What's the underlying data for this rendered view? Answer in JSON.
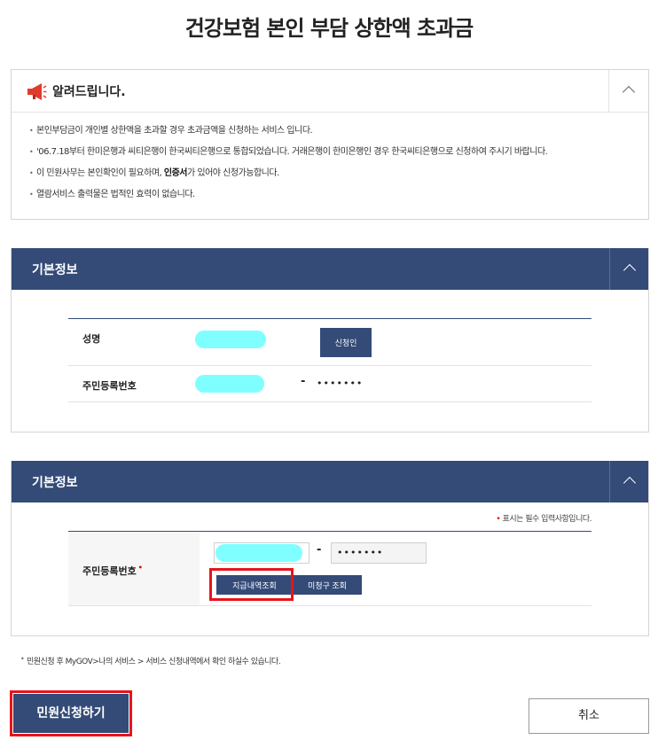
{
  "page": {
    "title": "건강보험 본인 부담 상한액 초과금"
  },
  "notice": {
    "title": "알려드립니다.",
    "icon": "megaphone-icon",
    "items": [
      {
        "text": "본인부담금이 개인별 상한액을 초과할 경우 초과금액을 신청하는 서비스 입니다."
      },
      {
        "text": "'06.7.18부터 한미은행과 씨티은행이 한국씨티은행으로 통합되었습니다. 거래은행이 한미은행인 경우 한국씨티은행으로 신청하여 주시기 바랍니다."
      },
      {
        "pre": "이 민원사무는 본인확인이 필요하며, ",
        "bold": "인증서",
        "post": "가 있어야 신청가능합니다."
      },
      {
        "text": "열람서비스 출력물은 법적인 효력이 없습니다."
      }
    ]
  },
  "section1": {
    "title": "기본정보",
    "name_label": "성명",
    "applicant_button": "신청인",
    "rrn_label": "주민등록번호",
    "rrn_dash": "-",
    "rrn_back": "•••••••"
  },
  "section2": {
    "title": "기본정보",
    "required_star": "•",
    "required_note": "표시는 필수 입력사항입니다.",
    "rrn_label": "주민등록번호",
    "rrn_star": "•",
    "rrn_dash": "-",
    "rrn_back": "•••••••",
    "payment_button": "지급내역조회",
    "unclaimed_button": "미청구 조회"
  },
  "footnote": "민원신청 후 MyGOV>나의 서비스 > 서비스 신청내역에서 확인 하실수 있습니다.",
  "actions": {
    "apply": "민원신청하기",
    "cancel": "취소"
  },
  "colors": {
    "navy": "#344b78",
    "highlight": "#e8141b",
    "masked": "#7fffff"
  }
}
